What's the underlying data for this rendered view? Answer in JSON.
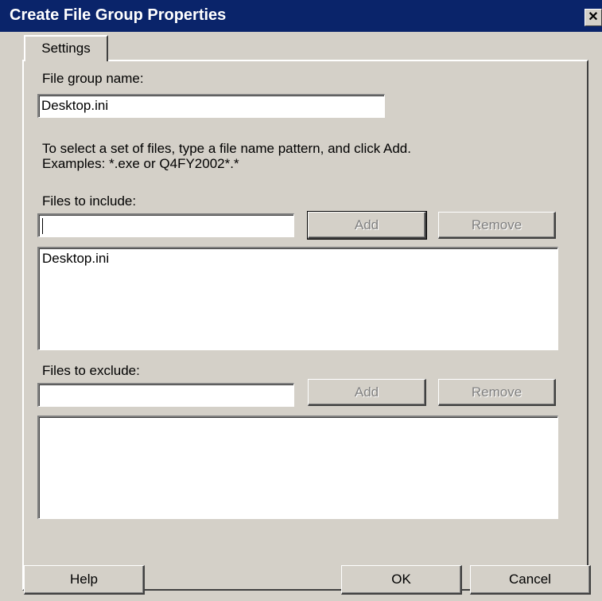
{
  "window": {
    "title": "Create File Group Properties",
    "close_glyph": "✕"
  },
  "tabs": [
    {
      "label": "Settings"
    }
  ],
  "file_group_name": {
    "label": "File group name:",
    "value": "Desktop.ini"
  },
  "instructions": {
    "line1": "To select a set of files, type a file name pattern, and click Add.",
    "line2": "Examples: *.exe or Q4FY2002*.*"
  },
  "include": {
    "label": "Files to include:",
    "input_value": "",
    "add_label": "Add",
    "remove_label": "Remove",
    "items": [
      "Desktop.ini"
    ]
  },
  "exclude": {
    "label": "Files to exclude:",
    "input_value": "",
    "add_label": "Add",
    "remove_label": "Remove",
    "items": []
  },
  "footer": {
    "help_label": "Help",
    "ok_label": "OK",
    "cancel_label": "Cancel"
  },
  "colors": {
    "title_bar": "#0a246a",
    "dialog_face": "#d4d0c8",
    "disabled_text": "#808080"
  }
}
